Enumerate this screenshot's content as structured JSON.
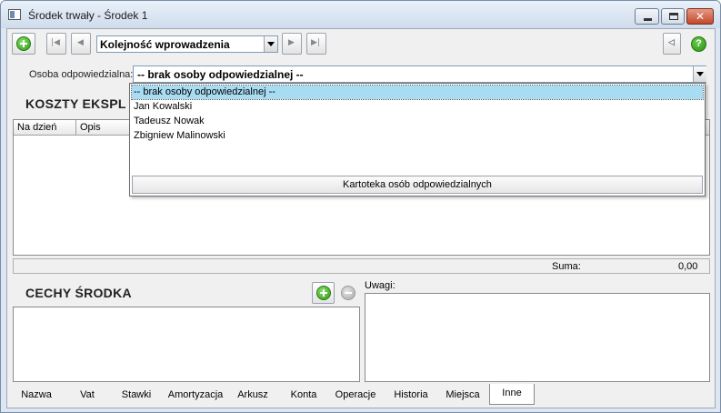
{
  "window": {
    "title": "Środek trwały - Środek 1",
    "close_glyph": "✕"
  },
  "toolbar": {
    "order_select_value": "Kolejność wprowadzenia",
    "help_glyph": "?",
    "first_glyph": "|◀",
    "prev_glyph": "◀",
    "next_glyph": "▶",
    "last_glyph": "▶|",
    "side_glyph": "◁"
  },
  "responsible": {
    "label": "Osoba odpowiedzialna:",
    "value": "-- brak osoby odpowiedzialnej --",
    "options": [
      "-- brak osoby odpowiedzialnej --",
      "Jan Kowalski",
      "Tadeusz Nowak",
      "Zbigniew Malinowski"
    ],
    "selected_index": 0,
    "footer_button": "Kartoteka osób odpowiedzialnych"
  },
  "costs": {
    "title": "KOSZTY EKSPL",
    "columns": [
      "Na dzień",
      "Opis"
    ],
    "sum_label": "Suma:",
    "sum_value": "0,00"
  },
  "features": {
    "title": "CECHY ŚRODKA"
  },
  "notes": {
    "label": "Uwagi:"
  },
  "tabs": [
    "Nazwa",
    "Vat",
    "Stawki",
    "Amortyzacja",
    "Arkusz",
    "Konta",
    "Operacje",
    "Historia",
    "Miejsca",
    "Inne"
  ],
  "active_tab": "Inne",
  "colors": {
    "selection": "#a8dcf2",
    "accent_green": "#2e9a16",
    "window_frame": "#7a8ea6",
    "close_button": "#c2472b"
  },
  "icons": {
    "add": "add-icon",
    "remove": "remove-icon",
    "help": "help-icon"
  }
}
